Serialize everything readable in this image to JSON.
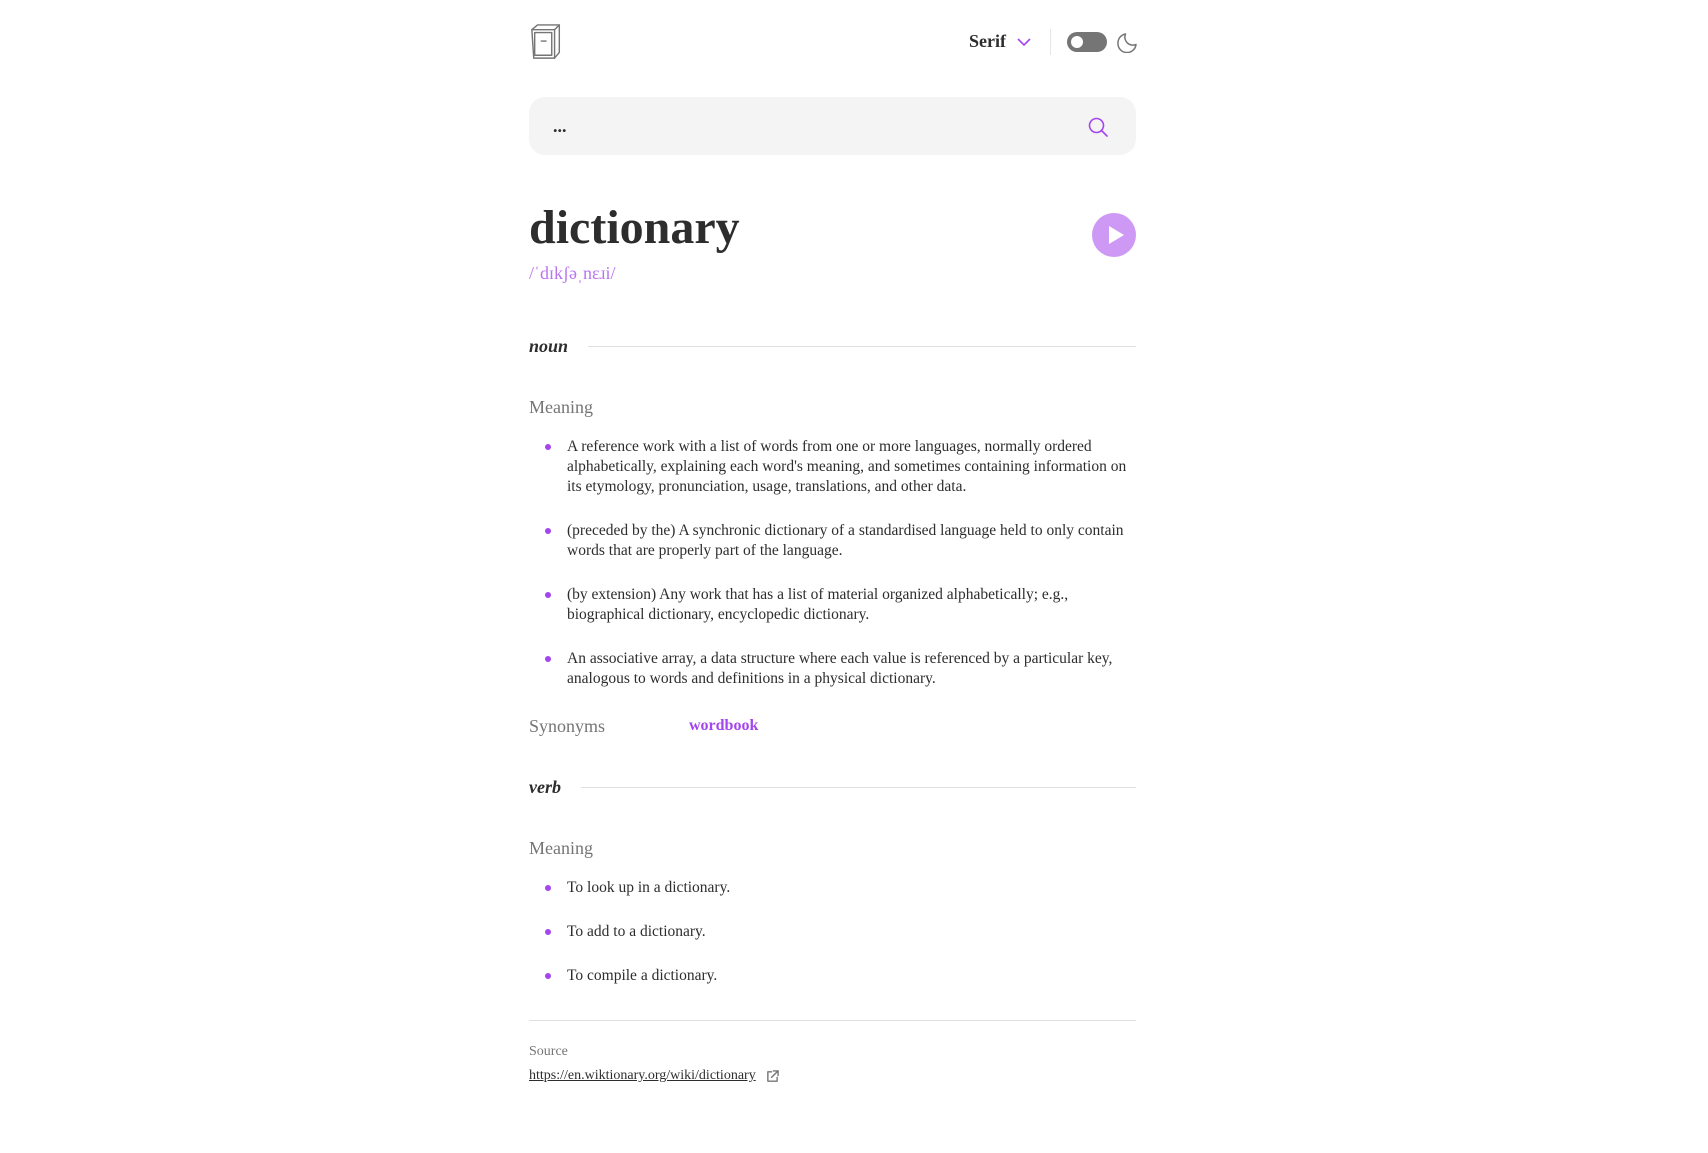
{
  "header": {
    "logo_icon": "book-icon",
    "font_selected": "Serif",
    "theme_toggle_icon": "toggle-switch-icon",
    "theme_icon": "moon-icon"
  },
  "search": {
    "placeholder": "...",
    "value": "",
    "icon": "search-icon"
  },
  "word": {
    "text": "dictionary",
    "phonetic": "/ˈdɪkʃəˌnɛɹi/",
    "play_icon": "play-icon"
  },
  "meanings": [
    {
      "part_of_speech": "noun",
      "meaning_label": "Meaning",
      "definitions": [
        "A reference work with a list of words from one or more languages, normally ordered alphabetically, explaining each word's meaning, and sometimes containing information on its etymology, pronunciation, usage, translations, and other data.",
        "(preceded by the) A synchronic dictionary of a standardised language held to only contain words that are properly part of the language.",
        "(by extension) Any work that has a list of material organized alphabetically; e.g., biographical dictionary, encyclopedic dictionary.",
        "An associative array, a data structure where each value is referenced by a particular key, analogous to words and definitions in a physical dictionary."
      ],
      "synonyms_label": "Synonyms",
      "synonyms": [
        "wordbook"
      ]
    },
    {
      "part_of_speech": "verb",
      "meaning_label": "Meaning",
      "definitions": [
        "To look up in a dictionary.",
        "To add to a dictionary.",
        "To compile a dictionary."
      ]
    }
  ],
  "source": {
    "label": "Source",
    "url": "https://en.wiktionary.org/wiki/dictionary",
    "icon": "external-link-icon"
  },
  "colors": {
    "accent": "#a445ed",
    "text": "#2d2d2d",
    "muted": "#757575",
    "divider": "#e0e0e0",
    "search_bg": "#f4f4f4"
  }
}
